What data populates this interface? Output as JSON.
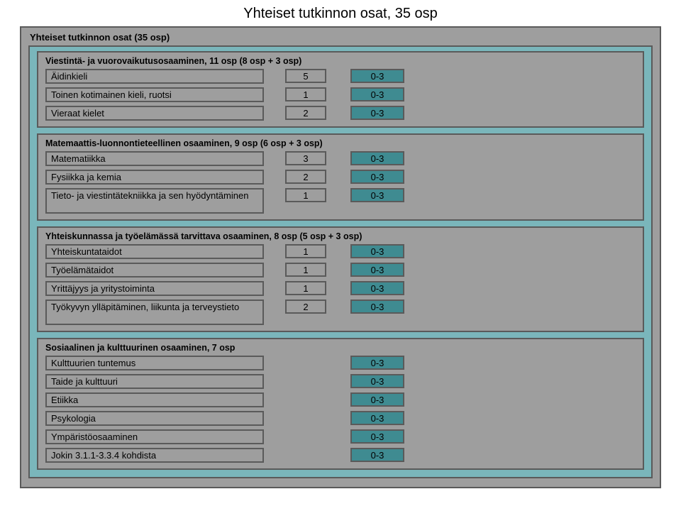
{
  "page_title": "Yhteiset tutkinnon osat, 35 osp",
  "outer_title": "Yhteiset tutkinnon osat (35 osp)",
  "sections": [
    {
      "title": "Viestintä- ja vuorovaikutusosaaminen, 11 osp (8 osp + 3 osp)",
      "rows": [
        {
          "name": "Äidinkieli",
          "val": "5",
          "range": "0-3"
        },
        {
          "name": "Toinen kotimainen kieli, ruotsi",
          "val": "1",
          "range": "0-3"
        },
        {
          "name": "Vieraat kielet",
          "val": "2",
          "range": "0-3"
        }
      ]
    },
    {
      "title": "Matemaattis-luonnontieteellinen osaaminen, 9 osp (6 osp + 3 osp)",
      "rows": [
        {
          "name": "Matematiikka",
          "val": "3",
          "range": "0-3"
        },
        {
          "name": "Fysiikka ja kemia",
          "val": "2",
          "range": "0-3"
        },
        {
          "name": "Tieto- ja viestintätekniikka ja sen hyödyntäminen",
          "val": "1",
          "range": "0-3",
          "tall": true
        }
      ]
    },
    {
      "title": "Yhteiskunnassa ja työelämässä tarvittava osaaminen, 8 osp (5 osp + 3 osp)",
      "rows": [
        {
          "name": "Yhteiskuntataidot",
          "val": "1",
          "range": "0-3"
        },
        {
          "name": "Työelämätaidot",
          "val": "1",
          "range": "0-3"
        },
        {
          "name": "Yrittäjyys ja yritystoiminta",
          "val": "1",
          "range": "0-3"
        },
        {
          "name": "Työkyvyn ylläpitäminen, liikunta ja terveystieto",
          "val": "2",
          "range": "0-3",
          "tall": true
        }
      ]
    },
    {
      "title": "Sosiaalinen ja kulttuurinen osaaminen, 7 osp",
      "rows": [
        {
          "name": "Kulttuurien tuntemus",
          "val": "",
          "range": "0-3"
        },
        {
          "name": "Taide ja kulttuuri",
          "val": "",
          "range": "0-3"
        },
        {
          "name": "Etiikka",
          "val": "",
          "range": "0-3"
        },
        {
          "name": "Psykologia",
          "val": "",
          "range": "0-3"
        },
        {
          "name": "Ympäristöosaaminen",
          "val": "",
          "range": "0-3"
        },
        {
          "name": "Jokin 3.1.1-3.3.4 kohdista",
          "val": "",
          "range": "0-3"
        }
      ]
    }
  ]
}
